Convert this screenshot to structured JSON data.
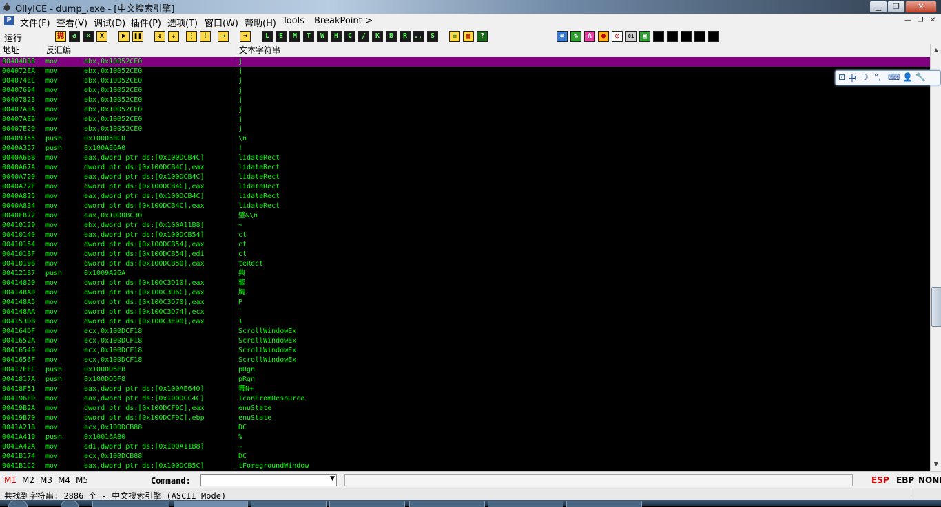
{
  "window": {
    "title": "OllyICE - dump_.exe - [中文搜索引擎]",
    "min_glyph": "▁",
    "max_glyph": "❐",
    "close_glyph": "✕",
    "app_icon": "bug-icon"
  },
  "menubar": {
    "app_icon_letter": "P",
    "items": [
      "文件(F)",
      "查看(V)",
      "调试(D)",
      "插件(P)",
      "选项(T)",
      "窗口(W)",
      "帮助(H)",
      "Tools",
      "BreakPoint->"
    ],
    "mdi_min": "—",
    "mdi_restore": "❐",
    "mdi_close": "✕"
  },
  "toolbar": {
    "run_label": "运行",
    "letter_buttons": [
      "L",
      "E",
      "M",
      "T",
      "W",
      "H",
      "C",
      "/",
      "K",
      "B",
      "R",
      "...",
      "S"
    ]
  },
  "columns": {
    "address": "地址",
    "disasm": "反汇编",
    "text": "文本字符串"
  },
  "rows": [
    {
      "addr": "00404D88",
      "mn": "mov",
      "op": "ebx,0x10052CE0",
      "str": "j",
      "selected": true
    },
    {
      "addr": "004072EA",
      "mn": "mov",
      "op": "ebx,0x10052CE0",
      "str": "j"
    },
    {
      "addr": "004074EC",
      "mn": "mov",
      "op": "ebx,0x10052CE0",
      "str": "j"
    },
    {
      "addr": "00407694",
      "mn": "mov",
      "op": "ebx,0x10052CE0",
      "str": "j"
    },
    {
      "addr": "00407823",
      "mn": "mov",
      "op": "ebx,0x10052CE0",
      "str": "j"
    },
    {
      "addr": "00407A3A",
      "mn": "mov",
      "op": "ebx,0x10052CE0",
      "str": "j"
    },
    {
      "addr": "00407AE9",
      "mn": "mov",
      "op": "ebx,0x10052CE0",
      "str": "j"
    },
    {
      "addr": "00407E29",
      "mn": "mov",
      "op": "ebx,0x10052CE0",
      "str": "j"
    },
    {
      "addr": "00409355",
      "mn": "push",
      "op": "0x100058C0",
      "str": "\\n"
    },
    {
      "addr": "0040A357",
      "mn": "push",
      "op": "0x100AE6A0",
      "str": "!"
    },
    {
      "addr": "0040A66B",
      "mn": "mov",
      "op": "eax,dword ptr ds:[0x100DCB4C]",
      "str": "lidateRect"
    },
    {
      "addr": "0040A67A",
      "mn": "mov",
      "op": "dword ptr ds:[0x100DCB4C],eax",
      "str": "lidateRect"
    },
    {
      "addr": "0040A720",
      "mn": "mov",
      "op": "eax,dword ptr ds:[0x100DCB4C]",
      "str": "lidateRect"
    },
    {
      "addr": "0040A72F",
      "mn": "mov",
      "op": "dword ptr ds:[0x100DCB4C],eax",
      "str": "lidateRect"
    },
    {
      "addr": "0040A825",
      "mn": "mov",
      "op": "eax,dword ptr ds:[0x100DCB4C]",
      "str": "lidateRect"
    },
    {
      "addr": "0040A834",
      "mn": "mov",
      "op": "dword ptr ds:[0x100DCB4C],eax",
      "str": "lidateRect"
    },
    {
      "addr": "0040F872",
      "mn": "mov",
      "op": "eax,0x1000BC30",
      "str": "璧&\\n"
    },
    {
      "addr": "00410129",
      "mn": "mov",
      "op": "ebx,dword ptr ds:[0x100A11B8]",
      "str": "~"
    },
    {
      "addr": "00410140",
      "mn": "mov",
      "op": "eax,dword ptr ds:[0x100DCB54]",
      "str": "ct"
    },
    {
      "addr": "00410154",
      "mn": "mov",
      "op": "dword ptr ds:[0x100DCB54],eax",
      "str": "ct"
    },
    {
      "addr": "0041018F",
      "mn": "mov",
      "op": "dword ptr ds:[0x100DCB54],edi",
      "str": "ct"
    },
    {
      "addr": "00410198",
      "mn": "mov",
      "op": "dword ptr ds:[0x100DCB50],eax",
      "str": "teRect"
    },
    {
      "addr": "00412187",
      "mn": "push",
      "op": "0x1009A26A",
      "str": "典"
    },
    {
      "addr": "00414820",
      "mn": "mov",
      "op": "dword ptr ds:[0x100C3D10],eax",
      "str": "鳌"
    },
    {
      "addr": "004148A0",
      "mn": "mov",
      "op": "dword ptr ds:[0x100C3D6C],eax",
      "str": "胸"
    },
    {
      "addr": "004148A5",
      "mn": "mov",
      "op": "dword ptr ds:[0x100C3D70],eax",
      "str": "P"
    },
    {
      "addr": "004148AA",
      "mn": "mov",
      "op": "dword ptr ds:[0x100C3D74],ecx",
      "str": "`"
    },
    {
      "addr": "004153DB",
      "mn": "mov",
      "op": "dword ptr ds:[0x100C3E90],eax",
      "str": "1"
    },
    {
      "addr": "004164DF",
      "mn": "mov",
      "op": "ecx,0x100DCF18",
      "str": "ScrollWindowEx"
    },
    {
      "addr": "0041652A",
      "mn": "mov",
      "op": "ecx,0x100DCF18",
      "str": "ScrollWindowEx"
    },
    {
      "addr": "00416549",
      "mn": "mov",
      "op": "ecx,0x100DCF18",
      "str": "ScrollWindowEx"
    },
    {
      "addr": "0041656F",
      "mn": "mov",
      "op": "ecx,0x100DCF18",
      "str": "ScrollWindowEx"
    },
    {
      "addr": "00417EFC",
      "mn": "push",
      "op": "0x100DD5F8",
      "str": "pRgn"
    },
    {
      "addr": "0041817A",
      "mn": "push",
      "op": "0x100DD5F8",
      "str": "pRgn"
    },
    {
      "addr": "00418F51",
      "mn": "mov",
      "op": "eax,dword ptr ds:[0x100AE640]",
      "str": "舞N+"
    },
    {
      "addr": "004196FD",
      "mn": "mov",
      "op": "eax,dword ptr ds:[0x100DCC4C]",
      "str": "IconFromResource"
    },
    {
      "addr": "00419B2A",
      "mn": "mov",
      "op": "dword ptr ds:[0x100DCF9C],eax",
      "str": "enuState"
    },
    {
      "addr": "00419B70",
      "mn": "mov",
      "op": "dword ptr ds:[0x100DCF9C],ebp",
      "str": "enuState"
    },
    {
      "addr": "0041A218",
      "mn": "mov",
      "op": "ecx,0x100DCB88",
      "str": "DC"
    },
    {
      "addr": "0041A419",
      "mn": "push",
      "op": "0x10016A80",
      "str": "%"
    },
    {
      "addr": "0041A42A",
      "mn": "mov",
      "op": "edi,dword ptr ds:[0x100A11B8]",
      "str": "~"
    },
    {
      "addr": "0041B174",
      "mn": "mov",
      "op": "ecx,0x100DCB88",
      "str": "DC"
    },
    {
      "addr": "0041B1C2",
      "mn": "mov",
      "op": "eax,dword ptr ds:[0x100DCB5C]",
      "str": "tForegroundWindow"
    }
  ],
  "ime": {
    "items": [
      "中",
      "☽",
      "°,",
      "⌨",
      "👤",
      "🔧"
    ]
  },
  "cmdbar": {
    "tabs": [
      "M1",
      "M2",
      "M3",
      "M4",
      "M5"
    ],
    "command_label": "Command:",
    "command_value": "",
    "regs": [
      "ESP",
      "EBP",
      "NONE"
    ]
  },
  "status": {
    "text": "共找到字符串: 2886 个  -  中文搜索引擎 (ASCII Mode)"
  },
  "colors": {
    "accent_selected": "#800080",
    "text_green": "#00ff00",
    "active_tab_red": "#e00000"
  }
}
